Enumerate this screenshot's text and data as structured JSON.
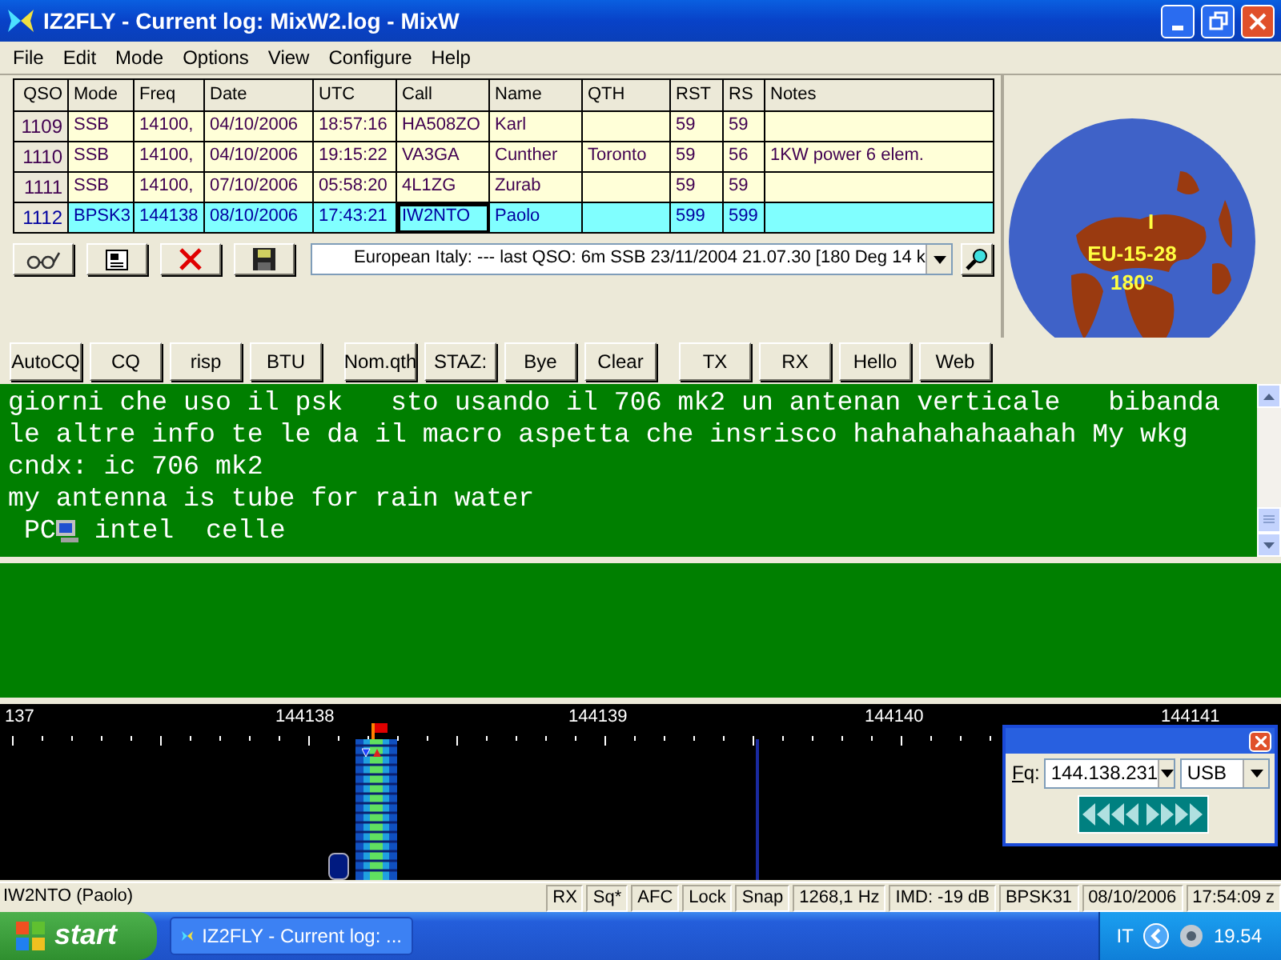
{
  "window": {
    "title": "IZ2FLY - Current log: MixW2.log - MixW"
  },
  "menu": [
    "File",
    "Edit",
    "Mode",
    "Options",
    "View",
    "Configure",
    "Help"
  ],
  "log_table": {
    "columns": [
      "QSO",
      "Mode",
      "Freq",
      "Date",
      "UTC",
      "Call",
      "Name",
      "QTH",
      "RST",
      "RS",
      "Notes"
    ],
    "rows": [
      {
        "qso": "1109",
        "mode": "SSB",
        "freq": "14100,",
        "date": "04/10/2006",
        "utc": "18:57:16",
        "call": "HA508ZO",
        "name": "Karl",
        "rst": "59",
        "rs": "59",
        "selected": false
      },
      {
        "qso": "1110",
        "mode": "SSB",
        "freq": "14100,",
        "date": "04/10/2006",
        "utc": "19:15:22",
        "call": "VA3GA",
        "name": "Cunther",
        "qth": "Toronto",
        "rst": "59",
        "rs": "56",
        "notes": "1KW power 6 elem.",
        "selected": false
      },
      {
        "qso": "1111",
        "mode": "SSB",
        "freq": "14100,",
        "date": "07/10/2006",
        "utc": "05:58:20",
        "call": "4L1ZG",
        "name": "Zurab",
        "rst": "59",
        "rs": "59",
        "selected": false
      },
      {
        "qso": "1112",
        "mode": "BPSK3",
        "freq": "144138",
        "date": "08/10/2006",
        "utc": "17:43:21",
        "call": "IW2NTO",
        "name": "Paolo",
        "rst": "599",
        "rs": "599",
        "selected": true
      }
    ]
  },
  "info_combo": {
    "value": "European Italy:  --- last QSO: 6m SSB 23/11/2004 21.07.30 [180 Deg  14 k"
  },
  "globe": {
    "labels": [
      "I",
      "EU-15-28",
      "180°"
    ]
  },
  "macro_groups": [
    [
      "AutoCQ",
      "CQ",
      "risp",
      "BTU"
    ],
    [
      "Nom.qth",
      "STAZ:",
      "Bye",
      "Clear"
    ],
    [
      "TX",
      "RX",
      "Hello",
      "Web"
    ]
  ],
  "rx_text": {
    "lines": [
      "giorni che uso il psk   sto usando il 706 mk2 un antenan verticale   bibanda",
      "le altre info te le da il macro aspetta che insrisco hahahahahaahah My wkg",
      "cndx: ic 706 mk2",
      "my antenna is tube for rain water"
    ],
    "last_line": {
      "before": " PC",
      "after": " intel  celle"
    }
  },
  "waterfall": {
    "scale": [
      "137",
      "144138",
      "144139",
      "144140",
      "144141"
    ]
  },
  "freq_window": {
    "field_label": "Fq:",
    "frequency": "144.138.231",
    "mode": "USB"
  },
  "status_bar": {
    "left": "IW2NTO (Paolo)",
    "cells": [
      "RX",
      "Sq*",
      "AFC",
      "Lock",
      "Snap",
      "1268,1 Hz",
      "IMD: -19 dB",
      "BPSK31",
      "08/10/2006",
      "17:54:09 z"
    ]
  },
  "taskbar": {
    "start": "start",
    "tasks": [
      {
        "label": "IZ2FLY - Current log: ...",
        "selected": false
      }
    ],
    "language": "IT",
    "clock": "19.54"
  }
}
